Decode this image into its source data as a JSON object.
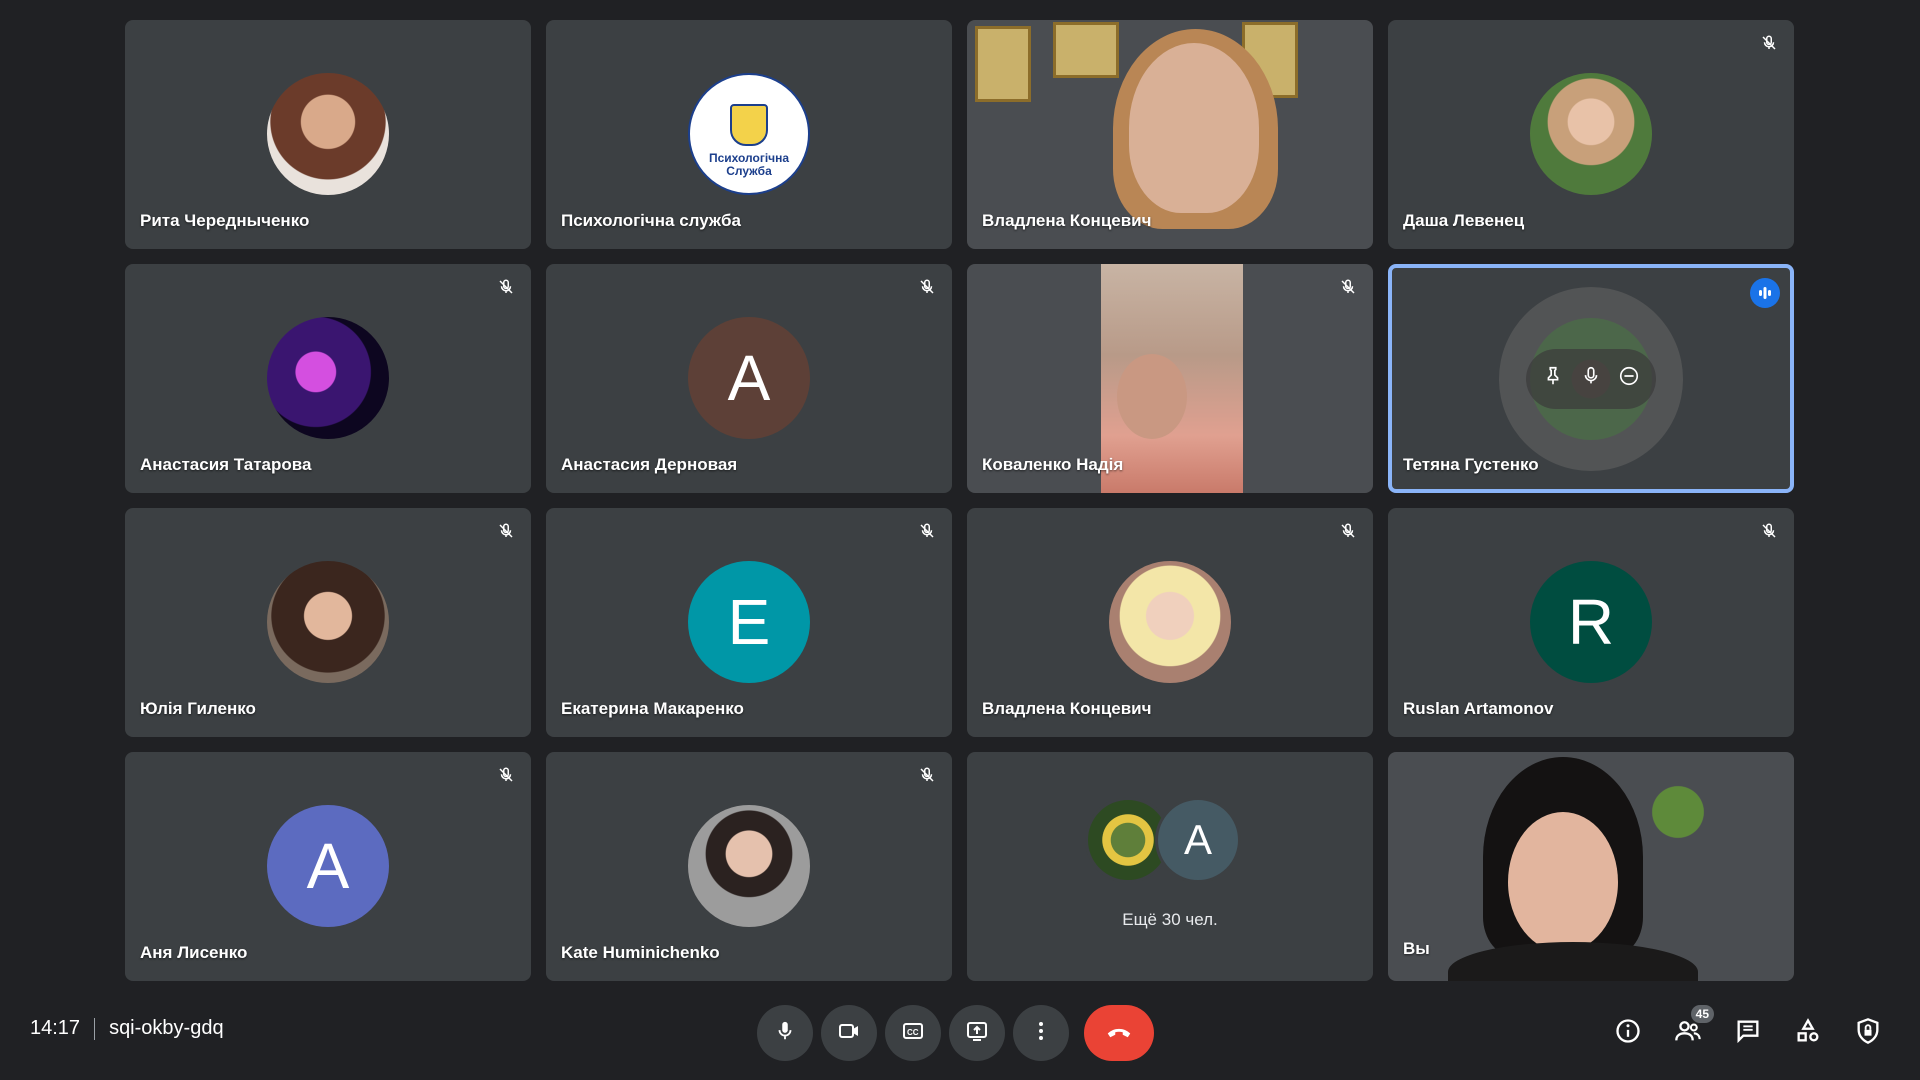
{
  "participants": [
    {
      "name": "Рита Чередныченко"
    },
    {
      "name": "Психологічна служба",
      "logo_text": "Психологічна Служба"
    },
    {
      "name": "Владлена Концевич"
    },
    {
      "name": "Даша Левенец"
    },
    {
      "name": "Анастасия Татарова"
    },
    {
      "name": "Анастасия Дерновая",
      "initial": "A",
      "color": "#5d4037"
    },
    {
      "name": "Коваленко Надія"
    },
    {
      "name": "Тетяна Густенко"
    },
    {
      "name": "Юлія Гиленко"
    },
    {
      "name": "Екатерина Макаренко",
      "initial": "E",
      "color": "#0097a7"
    },
    {
      "name": "Владлена Концевич"
    },
    {
      "name": "Ruslan Artamonov",
      "initial": "R",
      "color": "#004d40"
    },
    {
      "name": "Аня Лисенко",
      "initial": "A",
      "color": "#5c6bc0"
    },
    {
      "name": "Kate Huminichenko"
    },
    {
      "more_initial": "A",
      "more_label": "Ещё 30 чел."
    },
    {
      "name": "Вы"
    }
  ],
  "footer": {
    "time": "14:17",
    "meeting_code": "sqi-okby-gdq",
    "people_count": "45"
  },
  "colors": {
    "background": "#202124",
    "tile": "#3c4043",
    "end_call": "#ea4335",
    "active_border": "#8ab4f8",
    "speaking": "#1a73e8"
  },
  "icons": {
    "mute": "mic-off-icon",
    "speaking": "audio-bars-icon",
    "controls": [
      "mic-icon",
      "camera-icon",
      "captions-icon",
      "present-icon",
      "more-options-icon",
      "end-call-icon"
    ],
    "right": [
      "info-icon",
      "people-icon",
      "chat-icon",
      "activities-icon",
      "host-controls-icon"
    ]
  }
}
